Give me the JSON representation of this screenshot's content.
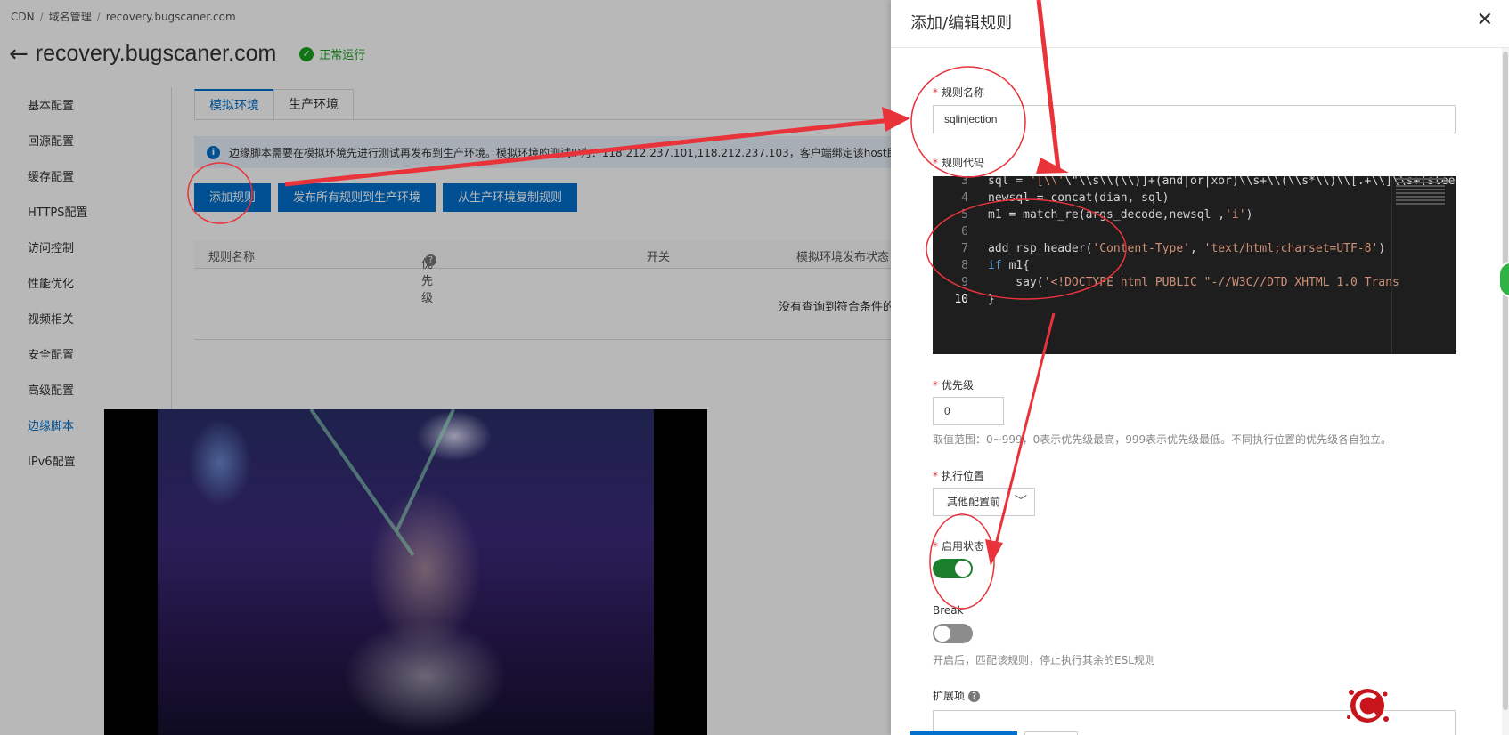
{
  "breadcrumb": {
    "items": [
      "CDN",
      "域名管理",
      "recovery.bugscaner.com"
    ]
  },
  "domain": {
    "title": "recovery.bugscaner.com",
    "status": "正常运行"
  },
  "sidebar": {
    "items": [
      {
        "label": "基本配置"
      },
      {
        "label": "回源配置"
      },
      {
        "label": "缓存配置"
      },
      {
        "label": "HTTPS配置"
      },
      {
        "label": "访问控制"
      },
      {
        "label": "性能优化"
      },
      {
        "label": "视频相关"
      },
      {
        "label": "安全配置"
      },
      {
        "label": "高级配置"
      },
      {
        "label": "边缘脚本"
      },
      {
        "label": "IPv6配置"
      }
    ],
    "active": "边缘脚本"
  },
  "tabs": [
    {
      "label": "模拟环境"
    },
    {
      "label": "生产环境"
    }
  ],
  "notice": {
    "text": "边缘脚本需要在模拟环境先进行测试再发布到生产环境。模拟环境的测试IP为：118.212.237.101,118.212.237.103，客户端绑定该host即可测试"
  },
  "buttons": {
    "add": "添加规则",
    "publish": "发布所有规则到生产环境",
    "copy": "从生产环境复制规则"
  },
  "table": {
    "columns": [
      "规则名称",
      "优先级",
      "开关",
      "模拟环境发布状态"
    ],
    "empty": "没有查询到符合条件的记录"
  },
  "drawer": {
    "title": "添加/编辑规则",
    "rule_name": {
      "label": "规则名称",
      "value": "sqlinjection"
    },
    "rule_code": {
      "label": "规则代码",
      "lines": [
        {
          "n": "3",
          "text": "sql = '[\\\\'\\\"\\\\s\\\\(\\\\)]+(and|or|xor)\\\\s+\\\\(\\\\s*\\\\)\\\\[.+\\\\]\\\\s+(sleep|if|like)|sleep\\\\s+'"
        },
        {
          "n": "4",
          "text": "newsql = concat(dian, sql)"
        },
        {
          "n": "5",
          "text": "m1 = match_re(args_decode,newsql ,'i')"
        },
        {
          "n": "6",
          "text": ""
        },
        {
          "n": "7",
          "text": "add_rsp_header('Content-Type', 'text/html;charset=UTF-8')"
        },
        {
          "n": "8",
          "text": "if m1{"
        },
        {
          "n": "9",
          "text": "    say('<!DOCTYPE html PUBLIC \"-//W3C//DTD XHTML 1.0 Trans"
        },
        {
          "n": "10",
          "text": "}"
        }
      ]
    },
    "priority": {
      "label": "优先级",
      "value": "0",
      "hint": "取值范围：0~999，0表示优先级最高，999表示优先级最低。不同执行位置的优先级各自独立。"
    },
    "position": {
      "label": "执行位置",
      "value": "其他配置前"
    },
    "enabled": {
      "label": "启用状态",
      "on": true
    },
    "break": {
      "label": "Break",
      "on": false,
      "hint": "开启后，匹配该规则，停止执行其余的ESL规则"
    },
    "extension": {
      "label": "扩展项"
    }
  },
  "colors": {
    "primary": "#0070cc",
    "success": "#1aa31e",
    "switch_on": "#1c7f2e",
    "annotation": "#e8333a"
  }
}
